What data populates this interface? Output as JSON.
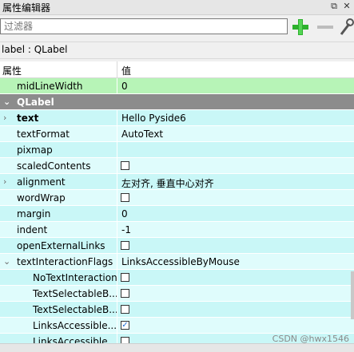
{
  "window": {
    "title": "属性编辑器",
    "float_icon": "⧉",
    "close_icon": "✕"
  },
  "toolbar": {
    "filter_placeholder": "过滤器",
    "add_icon": "plus-icon",
    "remove_icon": "minus-icon",
    "config_icon": "wrench-icon"
  },
  "object_label": "label : QLabel",
  "table": {
    "col_property": "属性",
    "col_value": "值",
    "rows": [
      {
        "name": "midLineWidth",
        "value": "0"
      },
      {
        "name": "QLabel",
        "value": ""
      },
      {
        "name": "text",
        "value": "Hello Pyside6"
      },
      {
        "name": "textFormat",
        "value": "AutoText"
      },
      {
        "name": "pixmap",
        "value": ""
      },
      {
        "name": "scaledContents",
        "value": ""
      },
      {
        "name": "alignment",
        "value": "左对齐, 垂直中心对齐"
      },
      {
        "name": "wordWrap",
        "value": ""
      },
      {
        "name": "margin",
        "value": "0"
      },
      {
        "name": "indent",
        "value": "-1"
      },
      {
        "name": "openExternalLinks",
        "value": ""
      },
      {
        "name": "textInteractionFlags",
        "value": "LinksAccessibleByMouse"
      },
      {
        "name": "NoTextInteraction",
        "value": ""
      },
      {
        "name": "TextSelectableB...",
        "value": ""
      },
      {
        "name": "TextSelectableB...",
        "value": ""
      },
      {
        "name": "LinksAccessible...",
        "value": ""
      },
      {
        "name": "LinksAccessible...",
        "value": ""
      }
    ]
  },
  "watermark": "CSDN @hwx1546",
  "colors": {
    "green_row": "#b7f4b7",
    "section_header": "#8c8c8c",
    "cyan_row": "#c9f7f7",
    "cyan_row_alt": "#dffcfc",
    "add_icon_green": "#2db12d"
  }
}
